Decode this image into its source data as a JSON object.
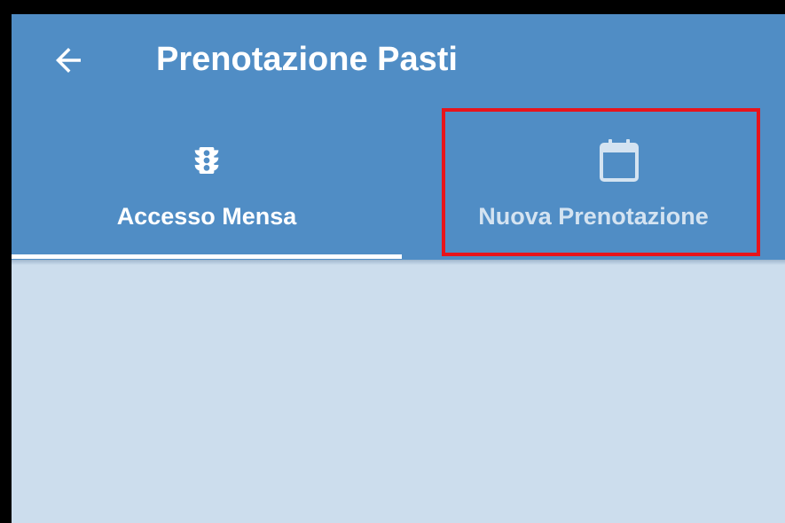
{
  "app_bar": {
    "title": "Prenotazione Pasti",
    "back_icon": "arrow-left-icon",
    "background_color": "#508dc5"
  },
  "tabs": [
    {
      "label": "Accesso Mensa",
      "icon": "traffic-light-icon",
      "selected": true
    },
    {
      "label": "Nuova Prenotazione",
      "icon": "calendar-icon",
      "selected": false
    }
  ],
  "annotation": {
    "highlight_color": "#e8141b",
    "target": "tab-nuova-prenotazione"
  },
  "content": {
    "background_color": "#ccdded"
  }
}
